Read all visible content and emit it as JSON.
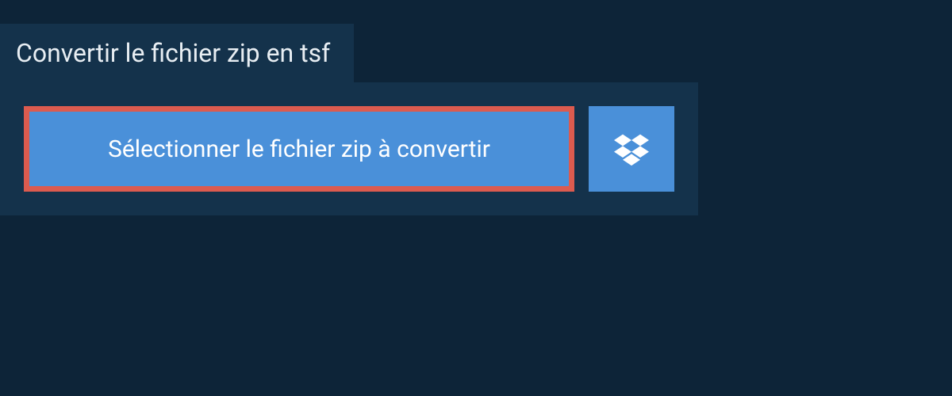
{
  "header": {
    "title": "Convertir le fichier zip en tsf"
  },
  "actions": {
    "select_file_label": "Sélectionner le fichier zip à convertir",
    "dropbox_icon": "dropbox-icon"
  },
  "colors": {
    "page_bg": "#0d2438",
    "panel_bg": "#14324b",
    "button_bg": "#4a90d9",
    "highlight_border": "#dc5b4f",
    "text": "#ffffff"
  }
}
